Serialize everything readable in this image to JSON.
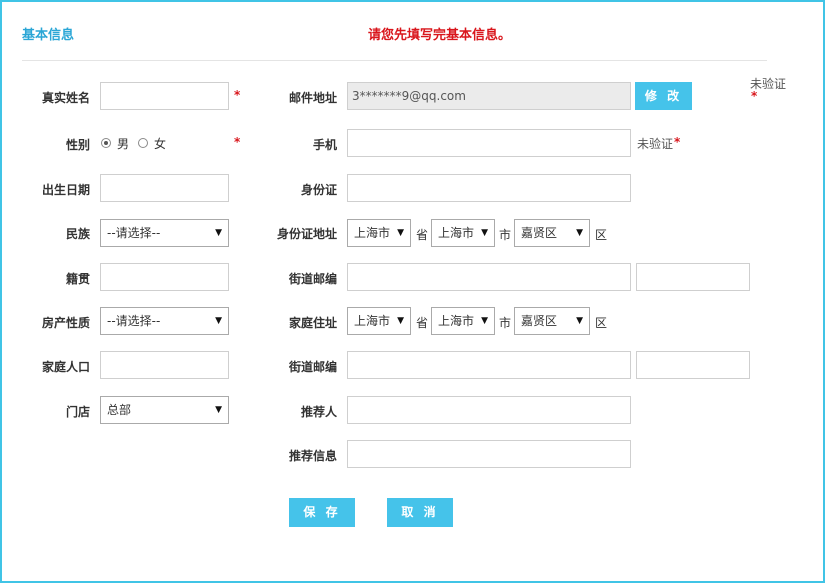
{
  "section_title": "基本信息",
  "notice": "请您先填写完基本信息。",
  "required_mark": "*",
  "left": {
    "real_name": {
      "label": "真实姓名",
      "value": ""
    },
    "gender": {
      "label": "性别",
      "male": "男",
      "female": "女",
      "selected": "男"
    },
    "birthdate": {
      "label": "出生日期",
      "value": ""
    },
    "ethnicity": {
      "label": "民族",
      "value": "--请选择--"
    },
    "native_place": {
      "label": "籍贯",
      "value": ""
    },
    "property": {
      "label": "房产性质",
      "value": "--请选择--"
    },
    "household": {
      "label": "家庭人口",
      "value": ""
    },
    "store": {
      "label": "门店",
      "value": "总部"
    }
  },
  "right": {
    "email": {
      "label": "邮件地址",
      "value": "3*******9@qq.com",
      "modify_label": "修 改",
      "status": "未验证"
    },
    "mobile": {
      "label": "手机",
      "value": "",
      "status": "未验证"
    },
    "id_card": {
      "label": "身份证",
      "value": ""
    },
    "id_address": {
      "label": "身份证地址",
      "province": "上海市",
      "city": "上海市",
      "district": "嘉贤区",
      "unit_province": "省",
      "unit_city": "市",
      "unit_district": "区"
    },
    "street_postcode_1": {
      "label": "街道邮编",
      "street": "",
      "postcode": ""
    },
    "home_address": {
      "label": "家庭住址",
      "province": "上海市",
      "city": "上海市",
      "district": "嘉贤区",
      "unit_province": "省",
      "unit_city": "市",
      "unit_district": "区"
    },
    "street_postcode_2": {
      "label": "街道邮编",
      "street": "",
      "postcode": ""
    },
    "referrer": {
      "label": "推荐人",
      "value": ""
    },
    "referrer_info": {
      "label": "推荐信息",
      "value": ""
    }
  },
  "buttons": {
    "save": "保 存",
    "cancel": "取 消"
  },
  "colors": {
    "accent": "#45c3ea",
    "title": "#2aa6d6",
    "notice": "#d9161c",
    "border": "#40c4e6"
  }
}
